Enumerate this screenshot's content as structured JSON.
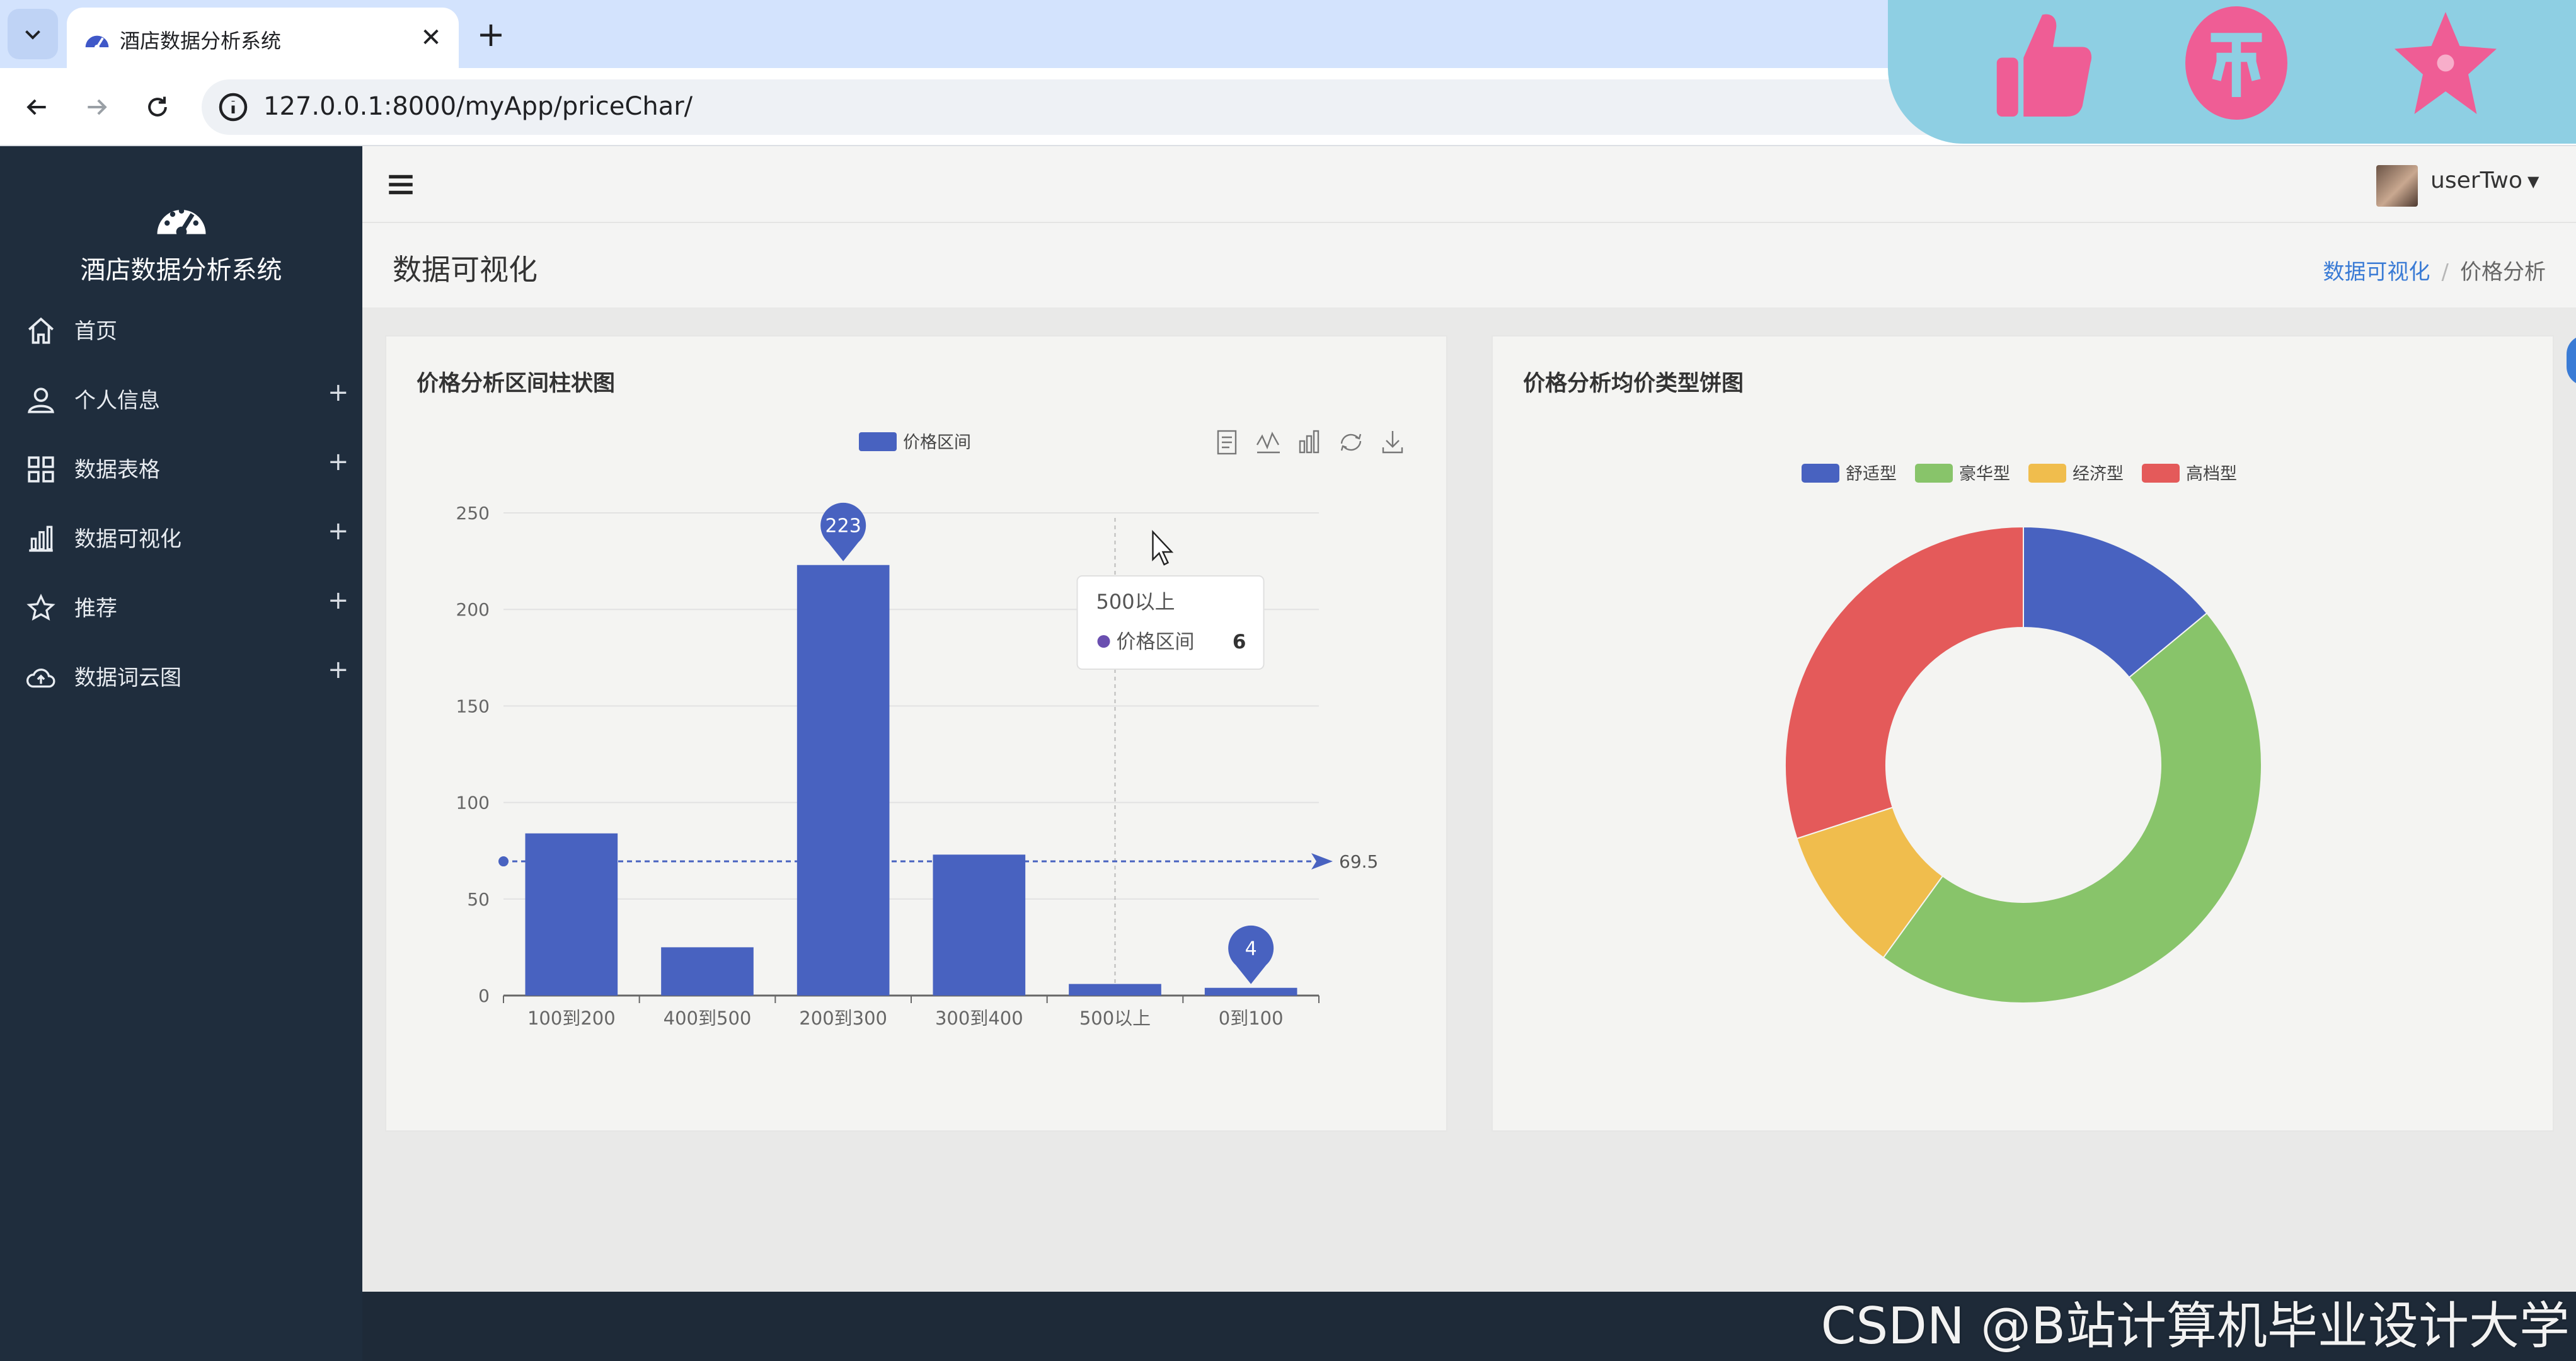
{
  "browser": {
    "tab_title": "酒店数据分析系统",
    "url": "127.0.0.1:8000/myApp/priceChar/"
  },
  "sidebar": {
    "brand": "酒店数据分析系统",
    "items": [
      {
        "label": "首页",
        "icon": "home-icon",
        "expandable": false
      },
      {
        "label": "个人信息",
        "icon": "user-icon",
        "expandable": true
      },
      {
        "label": "数据表格",
        "icon": "grid-icon",
        "expandable": true
      },
      {
        "label": "数据可视化",
        "icon": "bar-chart-icon",
        "expandable": true
      },
      {
        "label": "推荐",
        "icon": "star-icon",
        "expandable": true
      },
      {
        "label": "数据词云图",
        "icon": "cloud-icon",
        "expandable": true
      }
    ]
  },
  "header": {
    "user": "userTwo",
    "page_title": "数据可视化",
    "breadcrumb": [
      "数据可视化",
      "价格分析"
    ]
  },
  "panels": {
    "bar_title": "价格分析区间柱状图",
    "pie_title": "价格分析均价类型饼图"
  },
  "chart_data": [
    {
      "type": "bar",
      "legend": [
        "价格区间"
      ],
      "categories": [
        "100到200",
        "400到500",
        "200到300",
        "300到400",
        "500以上",
        "0到100"
      ],
      "values": [
        84,
        25,
        223,
        73,
        6,
        4
      ],
      "ylim": [
        0,
        250
      ],
      "yticks": [
        0,
        50,
        100,
        150,
        200,
        250
      ],
      "mark_points": [
        {
          "label": "223",
          "category": "200到300",
          "value": 223
        },
        {
          "label": "4",
          "category": "0到100",
          "value": 4
        }
      ],
      "mark_line": {
        "label": "69.5",
        "value": 69.5
      },
      "tooltip": {
        "category": "500以上",
        "series": "价格区间",
        "value": "6"
      },
      "color": "#4862c0"
    },
    {
      "type": "pie",
      "style": "donut",
      "legend": [
        "舒适型",
        "豪华型",
        "经济型",
        "高档型"
      ],
      "slices": [
        {
          "name": "舒适型",
          "value": 14,
          "color": "#4862c0"
        },
        {
          "name": "豪华型",
          "value": 46,
          "color": "#88c46a"
        },
        {
          "name": "经济型",
          "value": 10,
          "color": "#f0bd4d"
        },
        {
          "name": "高档型",
          "value": 30,
          "color": "#e45a5a"
        }
      ]
    }
  ],
  "watermark": "CSDN @B站计算机毕业设计大学"
}
